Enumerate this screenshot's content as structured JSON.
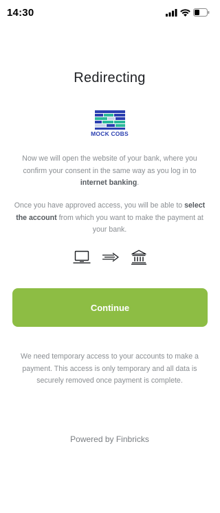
{
  "status_bar": {
    "time": "14:30",
    "icons": [
      "cellular-signal-icon",
      "wifi-icon",
      "battery-icon"
    ]
  },
  "title": "Redirecting",
  "bank": {
    "name": "MOCK COBS",
    "logo_icon": "bank-building-logo",
    "brand_colors": [
      "#2a3fb0",
      "#2bb89a",
      "#c8d3e8"
    ]
  },
  "intro": {
    "part1": "Now we will open the website of your bank, where you confirm your consent in the same way as you log in to ",
    "bold": "internet banking",
    "part2": "."
  },
  "instructions": {
    "part1": "Once you have approved access, you will be able to ",
    "bold": "select the account",
    "part2": " from which you want to make the payment at your bank."
  },
  "flow_icons": [
    "laptop-icon",
    "arrow-right-icon",
    "bank-icon"
  ],
  "continue_label": "Continue",
  "accent_color": "#8dbd44",
  "note": "We need temporary access to your accounts to make a payment. This access is only temporary and all data is securely removed once payment is complete.",
  "powered_by": "Powered by Finbricks"
}
